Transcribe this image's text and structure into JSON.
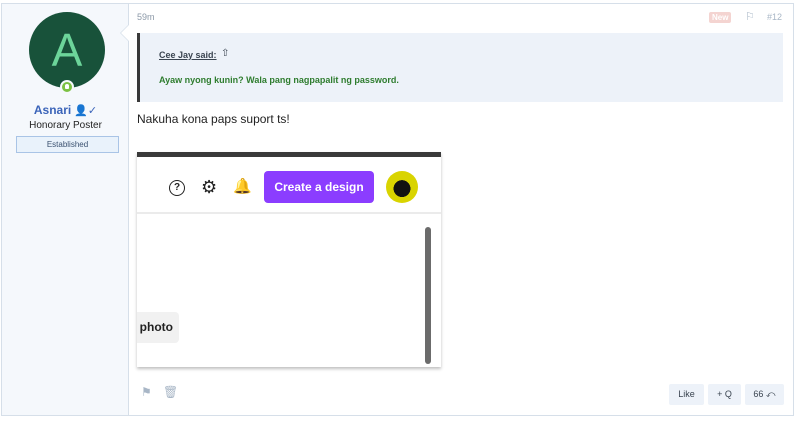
{
  "user": {
    "avatar_letter": "A",
    "name": "Asnari",
    "title": "Honorary Poster",
    "banner": "Established",
    "avatar_color": "#18523a"
  },
  "post": {
    "time": "59m",
    "new_badge": "New",
    "number": "#12",
    "quote": {
      "author": "Cee Jay said:",
      "text": "Ayaw nyong kunin? Wala pang nagpapalit ng password."
    },
    "message": "Nakuha kona paps suport ts!"
  },
  "screenshot": {
    "help_glyph": "?",
    "create_label": "Create a design",
    "photo_label": "photo",
    "accent": "#8b3dff"
  },
  "actions": {
    "like": "Like",
    "multiquote": "+ Q",
    "reply": "66 ⤺"
  }
}
